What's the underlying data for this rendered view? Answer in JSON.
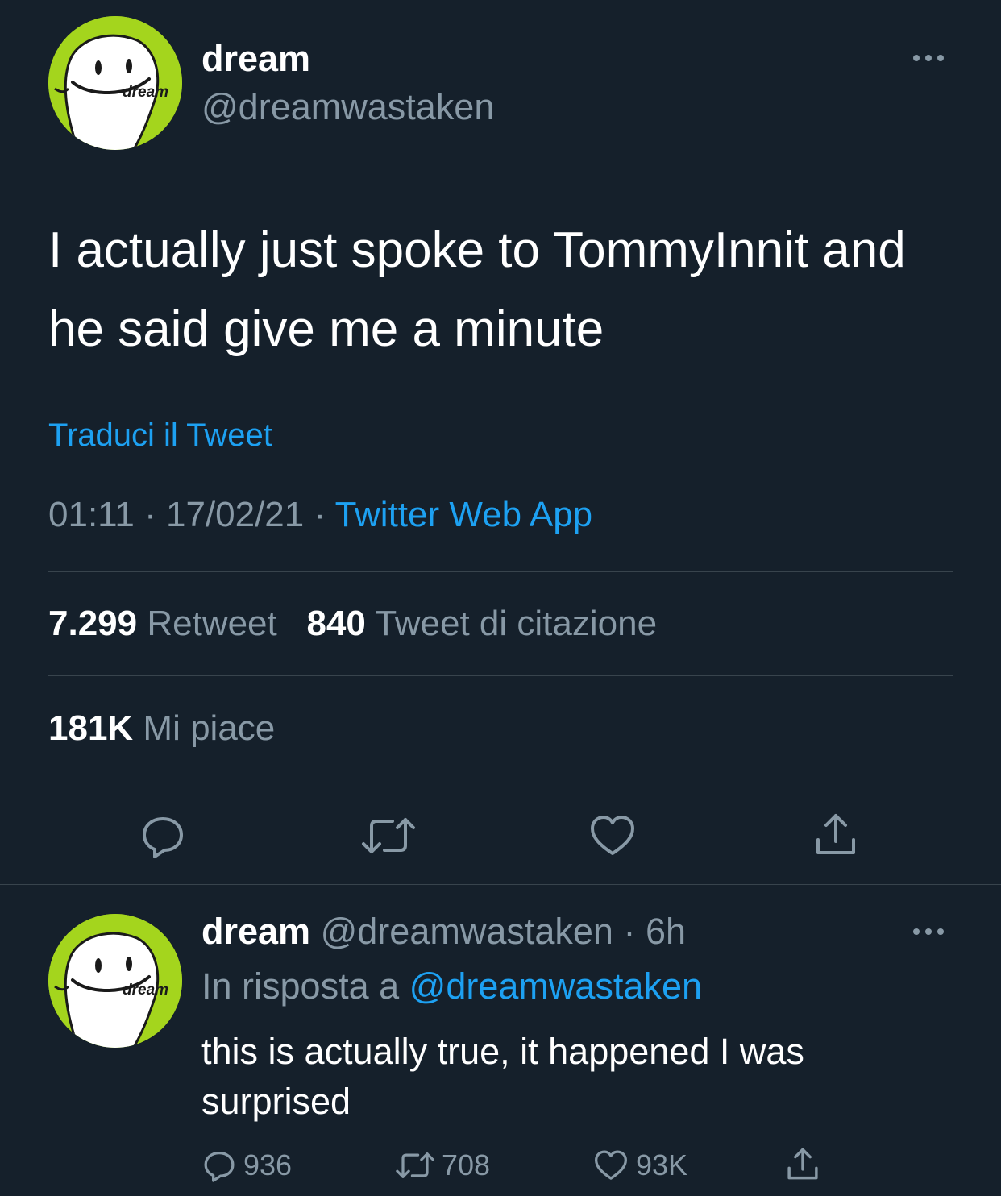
{
  "main_tweet": {
    "avatar_text": "dream",
    "display_name": "dream",
    "handle": "@dreamwastaken",
    "text": "I actually just spoke to TommyInnit and he said give me a minute",
    "translate_label": "Traduci il Tweet",
    "time": "01:11",
    "date": "17/02/21",
    "source": "Twitter Web App",
    "retweet_count": "7.299",
    "retweet_label": "Retweet",
    "quote_count": "840",
    "quote_label": "Tweet di citazione",
    "like_count": "181K",
    "like_label": "Mi piace",
    "actions": [
      "reply-icon",
      "retweet-icon",
      "like-icon",
      "share-icon"
    ]
  },
  "reply": {
    "avatar_text": "dream",
    "display_name": "dream",
    "handle": "@dreamwastaken",
    "age": "6h",
    "reply_prefix": "In risposta a",
    "reply_mention": "@dreamwastaken",
    "text": "this is actually true, it happened I was surprised",
    "reply_count": "936",
    "retweet_count": "708",
    "like_count": "93K"
  },
  "colors": {
    "background": "#15202b",
    "text": "#ffffff",
    "secondary": "#8899a6",
    "accent": "#1da1f2",
    "divider": "#38444d",
    "avatar_green": "#a4d51d"
  }
}
